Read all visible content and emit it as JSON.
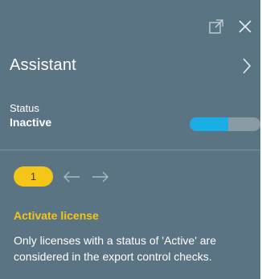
{
  "assistant": {
    "title": "Assistant",
    "status": {
      "label": "Status",
      "value": "Inactive",
      "progress_fraction": 0.55
    },
    "stepper": {
      "current_step": "1"
    },
    "step": {
      "title": "Activate license",
      "description": "Only licenses with a status of 'Active' are considered in the export control checks."
    }
  },
  "icons": {
    "open_external": "open-external-icon",
    "close": "close-icon",
    "chevron_right": "chevron-right-icon",
    "arrow_left": "arrow-left-icon",
    "arrow_right": "arrow-right-icon"
  },
  "colors": {
    "panel_bg": "#5b7484",
    "accent_yellow": "#f5c518",
    "progress_fill": "#1aaee6",
    "progress_track": "#8a9ba6",
    "muted_icon": "#a9bac4"
  }
}
